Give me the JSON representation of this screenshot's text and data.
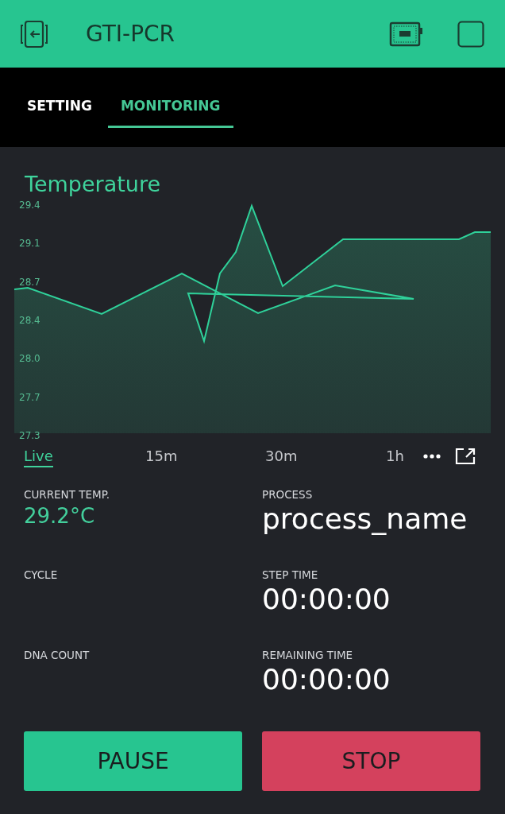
{
  "header": {
    "title": "GTI-PCR"
  },
  "tabs": [
    {
      "label": "SETTING",
      "selected": false
    },
    {
      "label": "MONITORING",
      "selected": true
    }
  ],
  "chart": {
    "title": "Temperature",
    "y_labels": [
      "29.4",
      "29.1",
      "28.7",
      "28.4",
      "28.0",
      "27.7",
      "27.3"
    ],
    "ranges": [
      {
        "label": "Live",
        "selected": true
      },
      {
        "label": "15m",
        "selected": false
      },
      {
        "label": "30m",
        "selected": false
      },
      {
        "label": "1h",
        "selected": false
      }
    ]
  },
  "fields": [
    {
      "label": "CURRENT TEMP.",
      "value": "29.2°C",
      "kind": "accent"
    },
    {
      "label": "PROCESS",
      "value": "process_name",
      "kind": "large"
    },
    {
      "label": "CYCLE",
      "kind": "empty"
    },
    {
      "label": "STEP TIME",
      "value": "00:00:00",
      "kind": "large"
    },
    {
      "label": "DNA COUNT",
      "kind": "empty"
    },
    {
      "label": "REMAINING TIME",
      "value": "00:00:00",
      "kind": "large"
    }
  ],
  "buttons": [
    {
      "label": "PAUSE",
      "color": "#27c590"
    },
    {
      "label": "STOP",
      "color": "#d4415d"
    }
  ]
}
